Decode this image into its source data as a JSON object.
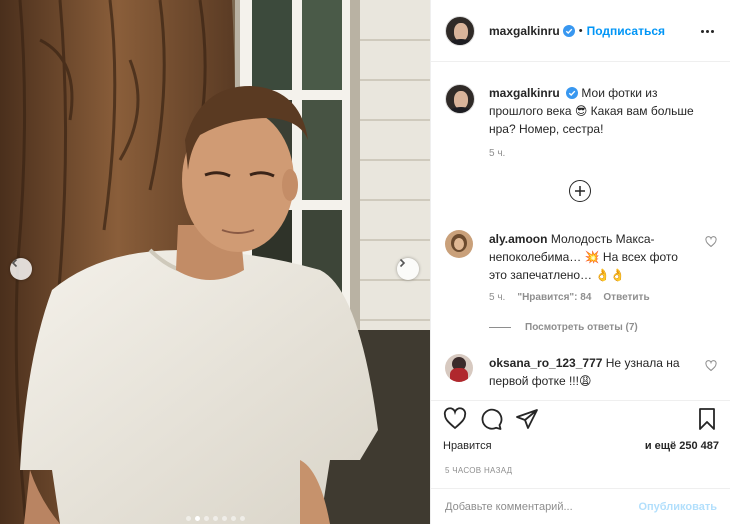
{
  "post": {
    "author": {
      "username": "maxgalkinru",
      "verified": true
    },
    "follow_label": "Подписаться",
    "caption_username": "maxgalkinru",
    "caption_text": "Мои фотки из прошлого века 😎 Какая вам больше нра? Номер, сестра!",
    "caption_time": "5 ч.",
    "carousel": {
      "slide_count": 7,
      "active_slide": 2
    },
    "comments": [
      {
        "username": "aly.amoon",
        "text": "Молодость Макса-непоколебима… 💥 На всех фото это запечатлено… 👌👌",
        "time": "5 ч.",
        "likes": "\"Нравится\": 84",
        "reply_label": "Ответить",
        "view_replies": "Посмотреть ответы (7)"
      },
      {
        "username": "oksana_ro_123_777",
        "text": "Не узнала на первой фотке !!!😩"
      }
    ],
    "like_label": "Нравится",
    "and_more": "и ещё 250 487",
    "posted_time": "5 ЧАСОВ НАЗАД",
    "add_comment_placeholder": "Добавьте комментарий...",
    "publish_label": "Опубликовать",
    "colors": {
      "accent": "#0095f6",
      "text": "#262626",
      "secondary": "#8e8e8e",
      "border": "#efefef",
      "publish_disabled": "#b2dffc"
    }
  }
}
